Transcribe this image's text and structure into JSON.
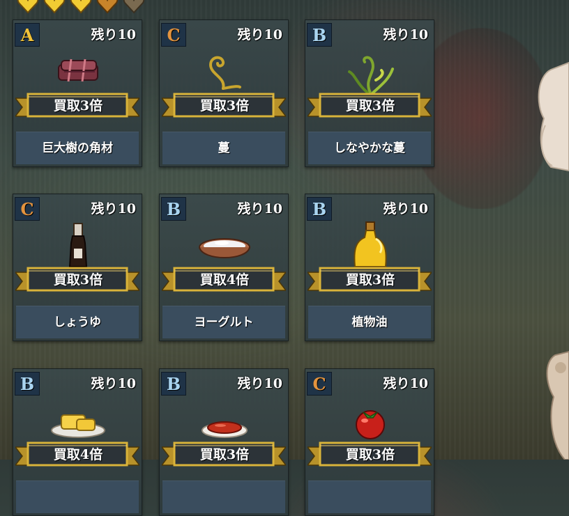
{
  "hearts": [
    "gold",
    "gold",
    "gold",
    "bronze",
    "gray"
  ],
  "colors": {
    "rank_A": "#f0c23a",
    "rank_B": "#a9d4f0",
    "rank_C": "#e3933e",
    "ribbon_gold": "#d9b33a",
    "ribbon_dark": "#2c3338",
    "name_bar": "#3a4d5e"
  },
  "cards": [
    {
      "rank": "A",
      "stock": "残り10",
      "multiplier": "買取3倍",
      "name": "巨大樹の角材",
      "icon": "lumber-icon"
    },
    {
      "rank": "C",
      "stock": "残り10",
      "multiplier": "買取3倍",
      "name": "蔓",
      "icon": "vine-icon"
    },
    {
      "rank": "B",
      "stock": "残り10",
      "multiplier": "買取3倍",
      "name": "しなやかな蔓",
      "icon": "supple-vine-icon"
    },
    {
      "rank": "C",
      "stock": "残り10",
      "multiplier": "買取3倍",
      "name": "しょうゆ",
      "icon": "soy-sauce-icon"
    },
    {
      "rank": "B",
      "stock": "残り10",
      "multiplier": "買取4倍",
      "name": "ヨーグルト",
      "icon": "yogurt-icon"
    },
    {
      "rank": "B",
      "stock": "残り10",
      "multiplier": "買取3倍",
      "name": "植物油",
      "icon": "oil-bottle-icon"
    },
    {
      "rank": "B",
      "stock": "残り10",
      "multiplier": "買取4倍",
      "name": "",
      "icon": "butter-icon"
    },
    {
      "rank": "B",
      "stock": "残り10",
      "multiplier": "買取3倍",
      "name": "",
      "icon": "tomato-sauce-icon"
    },
    {
      "rank": "C",
      "stock": "残り10",
      "multiplier": "買取3倍",
      "name": "",
      "icon": "tomato-icon"
    }
  ]
}
